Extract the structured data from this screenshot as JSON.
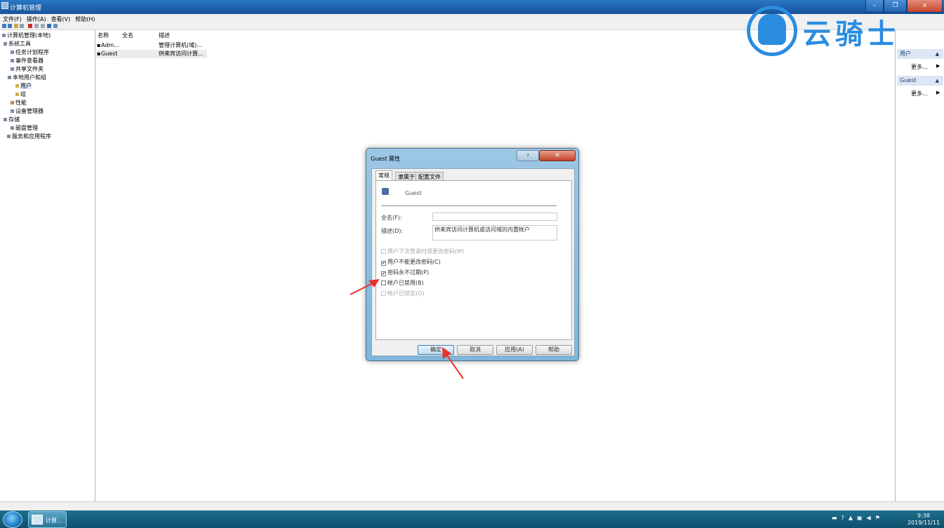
{
  "window": {
    "title": "计算机管理",
    "controls": {
      "minimize": "–",
      "maximize": "❐",
      "close": "x"
    }
  },
  "menu": [
    "文件(F)",
    "操作(A)",
    "查看(V)",
    "帮助(H)"
  ],
  "tree": {
    "root": "计算机管理(本地)",
    "items": [
      "系统工具",
      "任务计划程序",
      "事件查看器",
      "共享文件夹",
      "本地用户和组",
      "用户",
      "组",
      "性能",
      "设备管理器",
      "存储",
      "磁盘管理",
      "服务和应用程序"
    ]
  },
  "list": {
    "columns": [
      "名称",
      "全名",
      "描述"
    ],
    "rows": [
      {
        "name": "Adm...",
        "full": "",
        "desc": "管理计算机(域)..."
      },
      {
        "name": "Guest",
        "full": "",
        "desc": "供来宾访问计算..."
      }
    ]
  },
  "actions": {
    "sections": [
      {
        "title": "用户",
        "more": "更多..."
      },
      {
        "title": "Guest",
        "more": "更多..."
      }
    ]
  },
  "logo": {
    "text": "云骑士"
  },
  "dialog": {
    "title": "Guest 属性",
    "help_btn": "?",
    "close_btn": "✕",
    "tabs": [
      "常规",
      "隶属于",
      "配置文件"
    ],
    "username": "Guest",
    "fullname_label": "全名(F):",
    "fullname_value": "",
    "desc_label": "描述(D):",
    "desc_value": "供来宾访问计算机或访问域的内置帐户",
    "checkboxes": [
      {
        "label": "用户下次登录时须更改密码(M)",
        "checked": false,
        "disabled": true
      },
      {
        "label": "用户不能更改密码(C)",
        "checked": true,
        "disabled": false
      },
      {
        "label": "密码永不过期(P)",
        "checked": true,
        "disabled": false
      },
      {
        "label": "帐户已禁用(B)",
        "checked": false,
        "disabled": false
      },
      {
        "label": "帐户已锁定(O)",
        "checked": false,
        "disabled": true
      }
    ],
    "buttons": {
      "ok": "确定",
      "cancel": "取消",
      "apply": "应用(A)",
      "help": "帮助"
    }
  },
  "taskbar": {
    "task_label": "计算...",
    "time": "9:38",
    "date": "2019/11/11"
  },
  "colors": {
    "accent": "#2a8de0",
    "arrow": "#e8322b"
  }
}
